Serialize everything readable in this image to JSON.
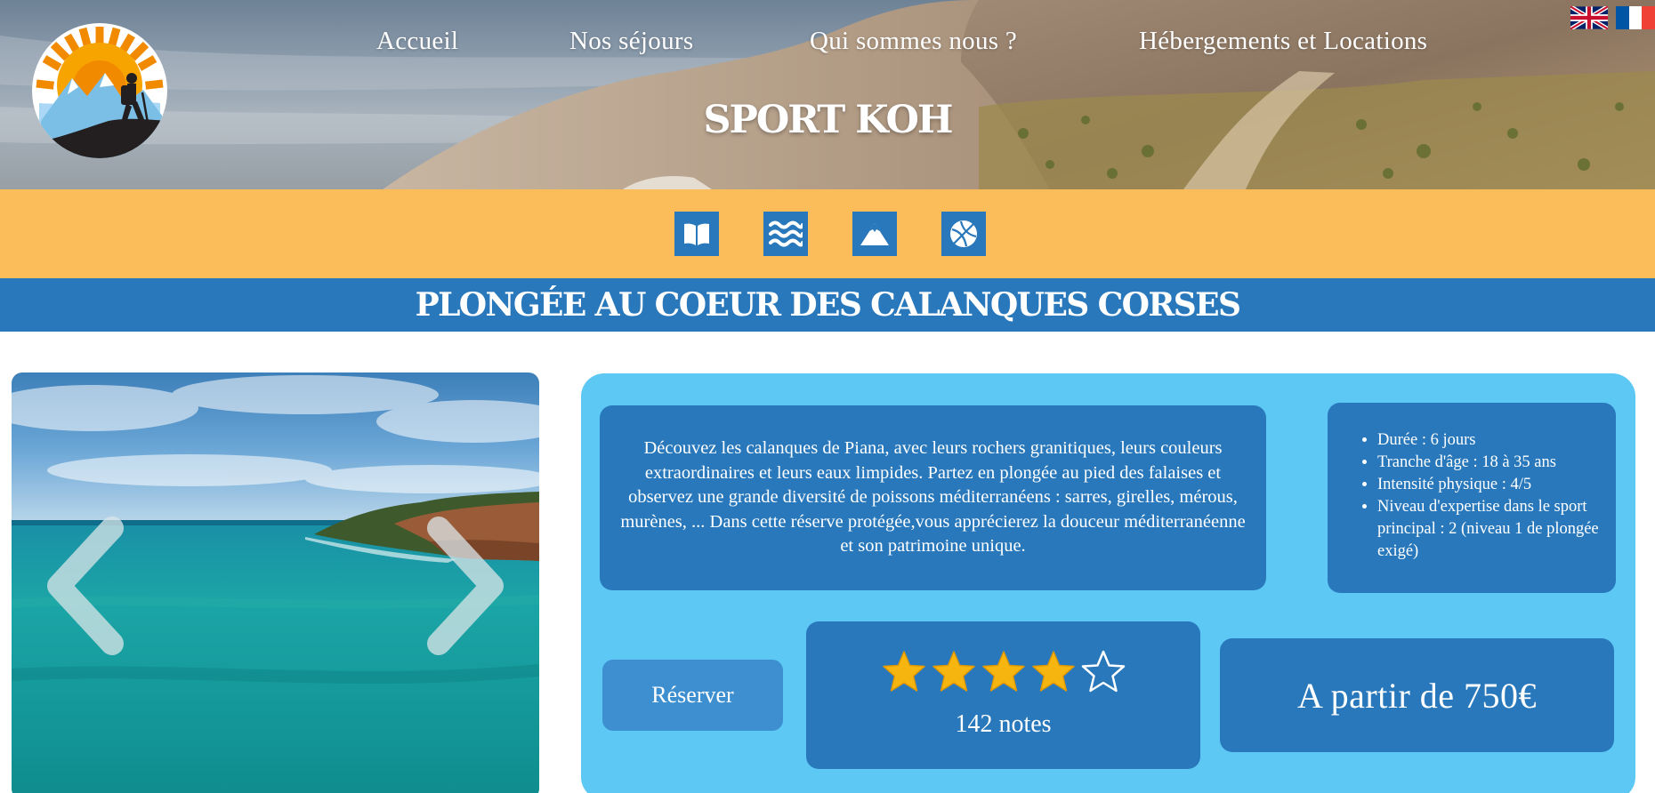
{
  "header": {
    "site_title": "SPORT KOH",
    "nav": [
      {
        "label": "Accueil"
      },
      {
        "label": "Nos séjours"
      },
      {
        "label": "Qui sommes nous ?"
      },
      {
        "label": "Hébergements et Locations"
      }
    ],
    "languages": [
      {
        "code": "en",
        "icon": "uk-flag-icon"
      },
      {
        "code": "fr",
        "icon": "france-flag-icon"
      }
    ]
  },
  "categories": [
    {
      "name": "culture",
      "icon": "open-book-icon"
    },
    {
      "name": "sea",
      "icon": "waves-icon"
    },
    {
      "name": "mountain",
      "icon": "mountain-icon"
    },
    {
      "name": "sports",
      "icon": "basketball-icon"
    }
  ],
  "page": {
    "title": "PLONGÉE AU COEUR DES CALANQUES CORSES"
  },
  "stay": {
    "description": "Découvez les calanques de Piana, avec leurs rochers granitiques, leurs couleurs extraordinaires et leurs eaux limpides. Partez en plongée au pied des falaises et observez une grande diversité de poissons méditerranéens : sarres, girelles, mérous, murènes, ... Dans cette réserve protégée,vous apprécierez la douceur méditerranéenne et son patrimoine unique.",
    "specs": [
      "Durée : 6 jours",
      "Tranche d'âge : 18 à 35 ans",
      "Intensité physique : 4/5",
      "Niveau d'expertise dans le sport principal : 2 (niveau 1 de plongée exigé)"
    ],
    "book_label": "Réserver",
    "rating": {
      "value": 4,
      "max": 5,
      "count_label": "142 notes"
    },
    "price_label": "A partir de 750€"
  },
  "colors": {
    "primary_blue": "#2878bb",
    "light_blue": "#5ec8f5",
    "orange": "#fbbc5a",
    "star_gold": "#f7b510"
  }
}
